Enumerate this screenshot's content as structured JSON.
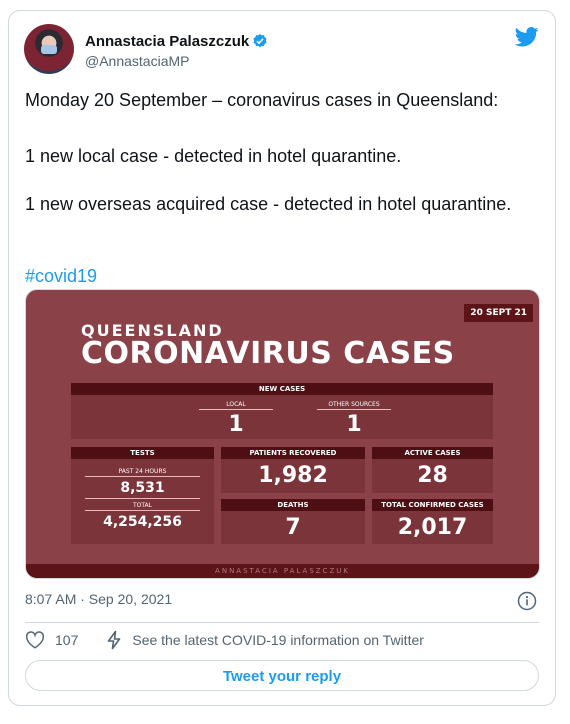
{
  "author": {
    "name": "Annastacia Palaszczuk",
    "handle": "@AnnastaciaMP"
  },
  "tweet": {
    "line1": "Monday 20 September – coronavirus cases in Queensland:",
    "line2": "1 new local case - detected in hotel quarantine.",
    "line3": "1 new overseas acquired case - detected in hotel quarantine.",
    "hashtag": "#covid19"
  },
  "media": {
    "date": "20 SEPT 21",
    "region": "QUEENSLAND",
    "title": "CORONAVIRUS CASES",
    "new_cases": {
      "header": "NEW CASES",
      "local_label": "LOCAL",
      "local_value": "1",
      "other_label": "OTHER SOURCES",
      "other_value": "1"
    },
    "tests": {
      "header": "TESTS",
      "past24_label": "PAST 24 HOURS",
      "past24_value": "8,531",
      "total_label": "TOTAL",
      "total_value": "4,254,256"
    },
    "recovered": {
      "header": "PATIENTS RECOVERED",
      "value": "1,982"
    },
    "active": {
      "header": "ACTIVE CASES",
      "value": "28"
    },
    "deaths": {
      "header": "DEATHS",
      "value": "7"
    },
    "confirmed": {
      "header": "TOTAL CONFIRMED CASES",
      "value": "2,017"
    },
    "footer": "ANNASTACIA PALASZCZUK"
  },
  "meta": {
    "timestamp": "8:07 AM · Sep 20, 2021",
    "like_count": "107",
    "covid_info_link": "See the latest COVID-19 information on Twitter",
    "reply_button": "Tweet your reply"
  },
  "colors": {
    "twitter_blue": "#1d9bf0",
    "media_background": "#8a4148",
    "panel_header": "#4d0e14"
  }
}
